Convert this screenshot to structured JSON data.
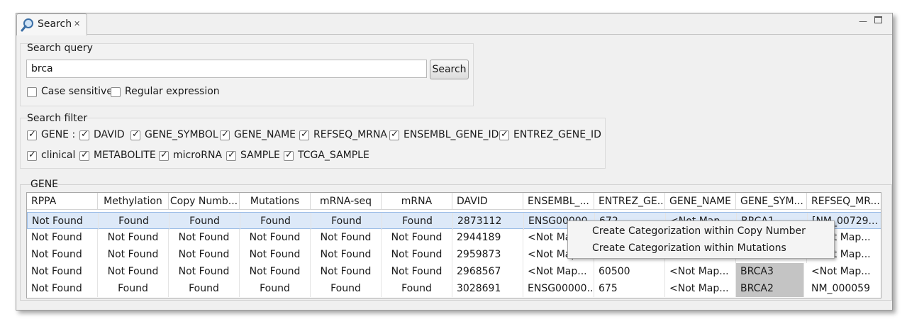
{
  "tab": {
    "label": "Search",
    "icon": "magnifier-icon"
  },
  "search_query": {
    "title": "Search query",
    "value": "brca",
    "button": "Search",
    "options": [
      {
        "label": "Case sensitive",
        "checked": false
      },
      {
        "label": "Regular expression",
        "checked": false
      }
    ]
  },
  "search_filter": {
    "title": "Search filter",
    "row1": [
      {
        "label": "GENE :",
        "checked": true
      },
      {
        "label": "DAVID",
        "checked": true
      },
      {
        "label": "GENE_SYMBOL",
        "checked": true
      },
      {
        "label": "GENE_NAME",
        "checked": true
      },
      {
        "label": "REFSEQ_MRNA",
        "checked": true
      },
      {
        "label": "ENSEMBL_GENE_ID",
        "checked": true
      },
      {
        "label": "ENTREZ_GENE_ID",
        "checked": true
      }
    ],
    "row2": [
      {
        "label": "clinical",
        "checked": true
      },
      {
        "label": "METABOLITE",
        "checked": true
      },
      {
        "label": "microRNA",
        "checked": true
      },
      {
        "label": "SAMPLE",
        "checked": true
      },
      {
        "label": "TCGA_SAMPLE",
        "checked": true
      }
    ]
  },
  "gene": {
    "title": "GENE",
    "columns": [
      "RPPA",
      "Methylation",
      "Copy Numb...",
      "Mutations",
      "mRNA-seq",
      "mRNA",
      "DAVID",
      "ENSEMBL_...",
      "ENTREZ_GE...",
      "GENE_NAME",
      "GENE_SYM...",
      "REFSEQ_MR..."
    ],
    "rows": [
      [
        "Not Found",
        "Found",
        "Found",
        "Found",
        "Found",
        "Found",
        "2873112",
        "ENSG00000...",
        "672",
        "<Not Map...",
        "BRCA1",
        "[NM_00729..."
      ],
      [
        "Not Found",
        "Not Found",
        "Not Found",
        "Not Found",
        "Not Found",
        "Not Found",
        "2944189",
        "<Not Map...",
        "",
        "",
        "",
        "<Not Map..."
      ],
      [
        "Not Found",
        "Not Found",
        "Not Found",
        "Not Found",
        "Not Found",
        "Not Found",
        "2959873",
        "<Not Map...",
        "",
        "",
        "",
        "<Not Map..."
      ],
      [
        "Not Found",
        "Not Found",
        "Not Found",
        "Not Found",
        "Not Found",
        "Not Found",
        "2968567",
        "<Not Map...",
        "60500",
        "<Not Map...",
        "BRCA3",
        "<Not Map..."
      ],
      [
        "Not Found",
        "Found",
        "Found",
        "Found",
        "Found",
        "Found",
        "3028691",
        "ENSG00000...",
        "675",
        "<Not Map...",
        "BRCA2",
        "NM_000059"
      ]
    ],
    "selected_row": 0
  },
  "context_menu": {
    "items": [
      "Create Categorization within Copy Number",
      "Create Categorization within Mutations"
    ]
  }
}
